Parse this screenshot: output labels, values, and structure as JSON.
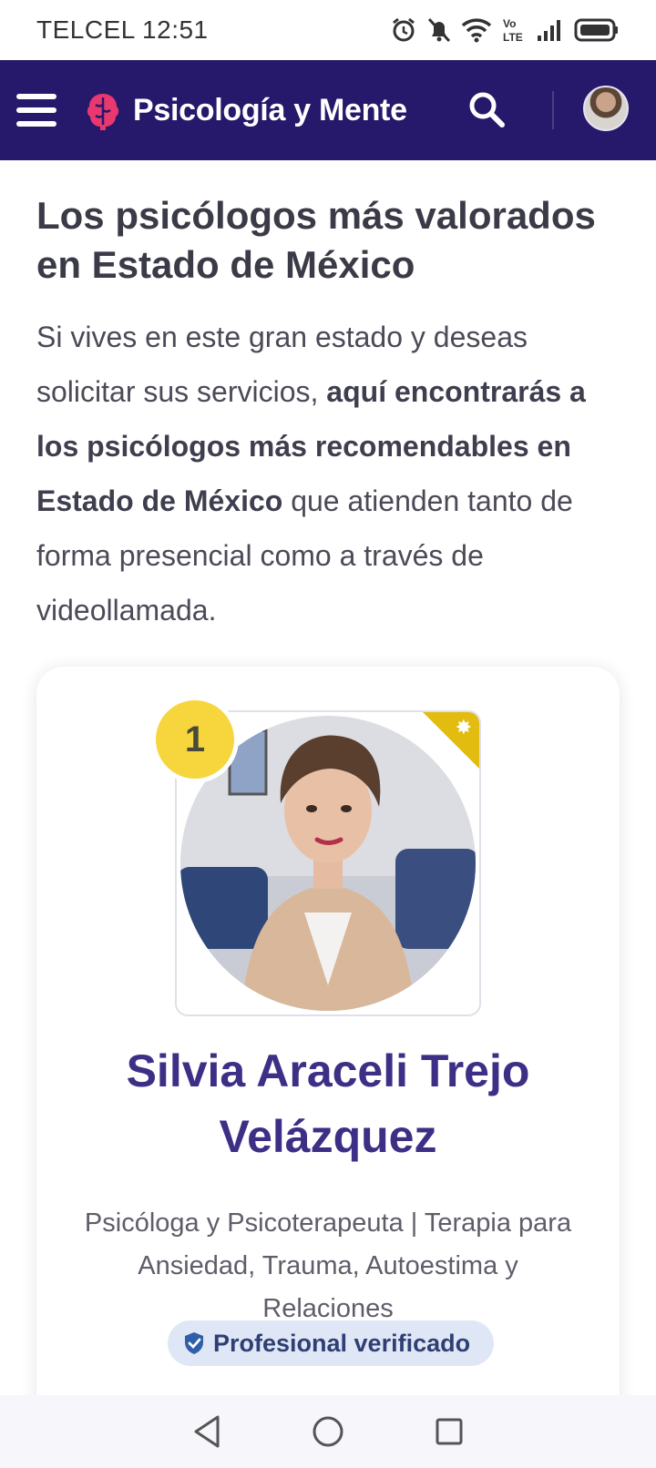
{
  "status_bar": {
    "carrier_time": "TELCEL 12:51",
    "icons": [
      "alarm-icon",
      "mute-bell-icon",
      "wifi-icon",
      "volte-icon",
      "signal-icon",
      "battery-icon"
    ],
    "volte_label": "Vo LTE"
  },
  "header": {
    "brand": "Psicología y Mente",
    "brand_color": "#26186a",
    "logo_color": "#e8386f"
  },
  "main": {
    "title": "Los psicólogos más valorados en Estado de México",
    "intro_pre": "Si vives en este gran estado y deseas solicitar sus servicios, ",
    "intro_bold": "aquí encontrarás a los psicólogos más recomendables en Estado de México",
    "intro_post": " que atienden tanto de forma presencial como a través de videollamada."
  },
  "card": {
    "rank": "1",
    "name": "Silvia Araceli Trejo Velázquez",
    "description": "Psicóloga y Psicoterapeuta | Terapia para Ansiedad, Trauma, Autoestima y Relaciones",
    "verified_label": "Profesional verificado",
    "accent_color": "#3d2f86",
    "rank_color": "#f6d63c"
  },
  "nav": {
    "icons": [
      "back-icon",
      "home-icon",
      "recents-icon"
    ]
  }
}
